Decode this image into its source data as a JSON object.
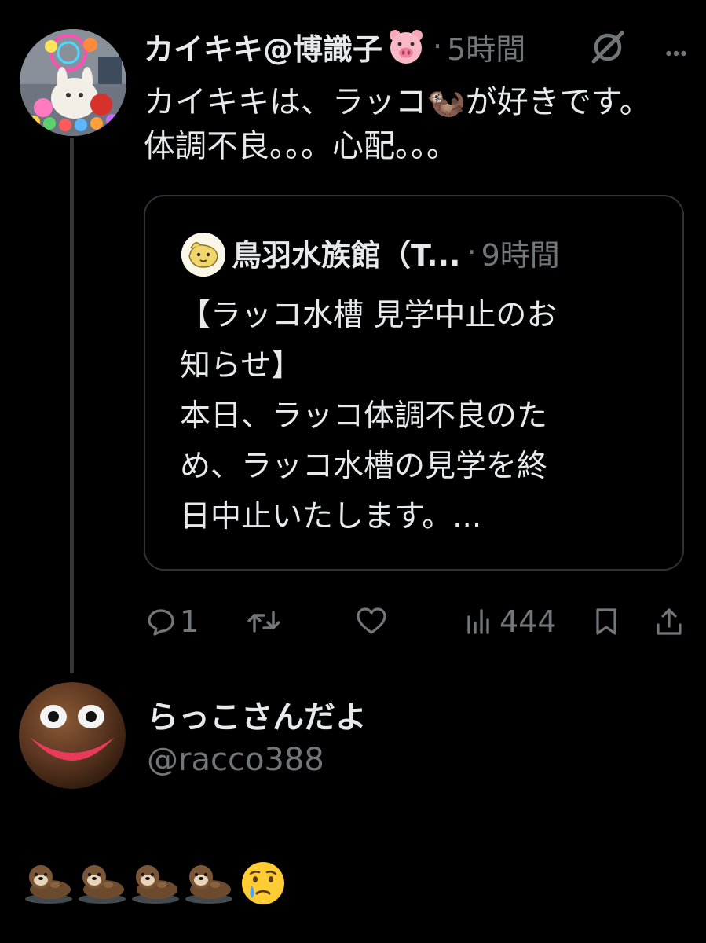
{
  "tweet": {
    "author_name": "カイキキ@博識子",
    "author_emoji": "pig-face-emoji",
    "separator": "·",
    "time": "5時間",
    "body": "カイキキは、ラッコ🦦が好きです。\n体調不良。。。心配。。。"
  },
  "quoted": {
    "author_name": "鳥羽水族館（T...",
    "separator": "·",
    "time": "9時間",
    "body": "【ラッコ水槽 見学中止のお\n知らせ】\n本日、ラッコ体調不良のた\nめ、ラッコ水槽の見学を終\n日中止いたします。..."
  },
  "actions": {
    "reply_count": "1",
    "retweet_count": "",
    "like_count": "",
    "view_count": "444"
  },
  "reply": {
    "display_name": "らっこさんだよ",
    "handle": "@racco388",
    "content_icons": [
      "sea-otter-emoji",
      "sea-otter-emoji",
      "sea-otter-emoji",
      "sea-otter-emoji",
      "crying-face-emoji"
    ]
  },
  "colors": {
    "background": "#000000",
    "text": "#e7e9ea",
    "secondary": "#71767b",
    "border": "#2f3336"
  }
}
